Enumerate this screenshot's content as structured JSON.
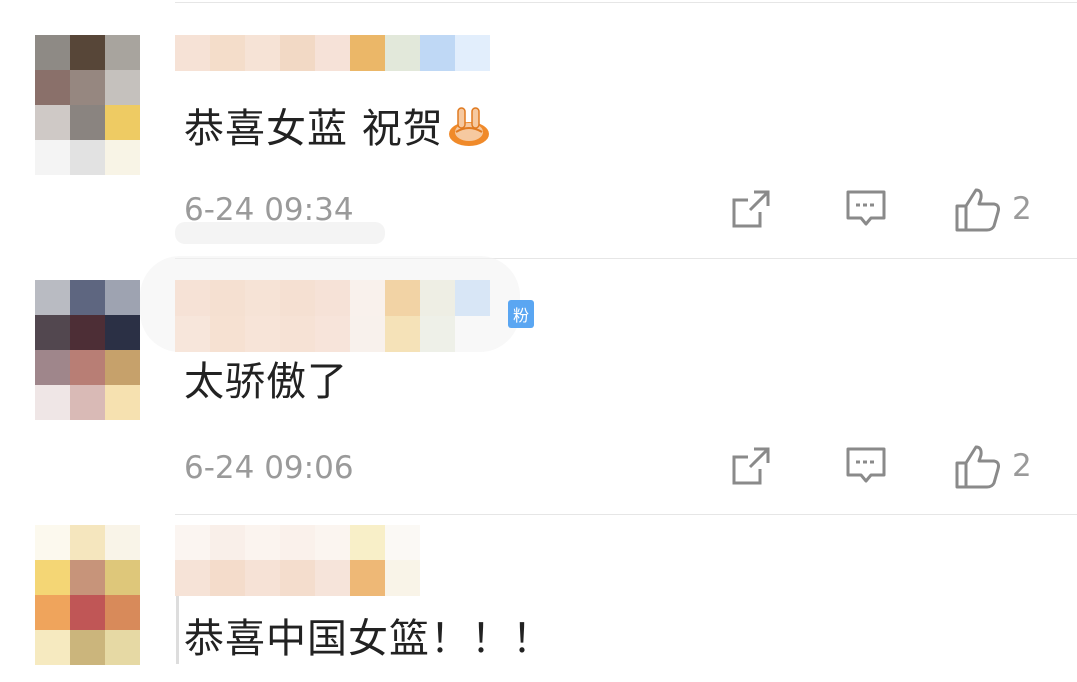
{
  "comments": [
    {
      "text": "恭喜女蓝 祝贺",
      "emoji": "victory-hand-emoji",
      "time": "6-24 09:34",
      "likes": "2"
    },
    {
      "text": "太骄傲了",
      "badge": "粉",
      "time": "6-24 09:06",
      "likes": "2"
    },
    {
      "text": "恭喜中国女篮！！！"
    }
  ],
  "icons": {
    "share": "share-icon",
    "reply": "comment-icon",
    "like": "thumbs-up-icon"
  },
  "colors": {
    "text": "#222222",
    "meta": "#9a9a9a",
    "badge": "#5aa6f2"
  }
}
